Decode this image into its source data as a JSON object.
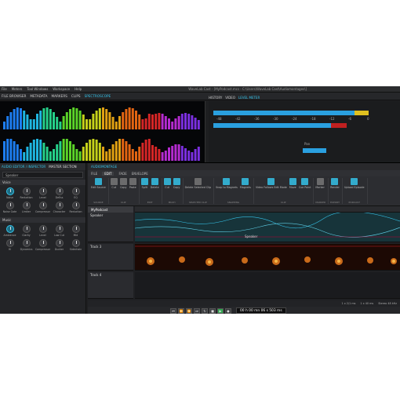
{
  "window": {
    "title": "WaveLab Cast - [MyPodcast.mcs - C:\\Users\\WaveLab Cast\\Audiomontages\\]"
  },
  "menu": [
    "File",
    "Meters",
    "Tool Windows",
    "Workspace",
    "Help"
  ],
  "top_tabs": [
    "FILE BROWSER",
    "METADATA",
    "MARKERS",
    "CLIPS",
    "SPECTROSCOPE"
  ],
  "top_tabs_active": 4,
  "right_tabs": [
    "HISTORY",
    "VIDEO",
    "LEVEL METER"
  ],
  "right_tabs_active": 2,
  "level_meter": {
    "scale": [
      "-48",
      "-42",
      "-36",
      "-30",
      "-24",
      "-18",
      "-12",
      "-6",
      "0"
    ],
    "mode_label": "Pan"
  },
  "left_panel": {
    "tabs": [
      "AUDIO EDITOR / INSPECTOR",
      "MASTER SECTION"
    ],
    "preset": "Speaker",
    "section_1": "Voice",
    "section_2": "Music",
    "knobs_1": [
      "Noise",
      "Reduction",
      "Level",
      "DeEss",
      "EQ",
      "Noise Gate",
      "Limiter",
      "Compressor",
      "Character",
      "Reduction"
    ],
    "knobs_2": [
      "Ambience",
      "Clarity",
      "Level",
      "Low Cut",
      "Mid",
      "Hi",
      "Dynamics",
      "Compressor",
      "Ducker",
      "Sidechain"
    ]
  },
  "editor": {
    "doc_tabs": [
      "AUDIOMONTAGE",
      "EDIT",
      "FADE",
      "ENVELOPE"
    ],
    "doc_tabs_active": 0,
    "ribbon_tabs": [
      "FILE",
      "EDIT",
      "FADE",
      "ENVELOPE"
    ],
    "ribbon_tabs_active": 1,
    "ribbon_groups": [
      {
        "label": "SOURCE",
        "buttons": [
          "Edit Source"
        ]
      },
      {
        "label": "CLIP",
        "buttons": [
          "Cut",
          "Copy",
          "Paste"
        ]
      },
      {
        "label": "EDIT",
        "buttons": [
          "Split",
          "Delete"
        ]
      },
      {
        "label": "MULTI",
        "buttons": [
          "Cut",
          "Copy"
        ]
      },
      {
        "label": "SELECTED CLIP",
        "buttons": [
          "Delete Selected Clip"
        ]
      },
      {
        "label": "SNAPPING",
        "buttons": [
          "Snap to Magnets",
          "Magnets"
        ]
      },
      {
        "label": "CLIP",
        "buttons": [
          "Video Follows Edit Mode",
          "Move",
          "Cue Point"
        ]
      },
      {
        "label": "MARKER",
        "buttons": [
          "Marker"
        ]
      },
      {
        "label": "EXPORT",
        "buttons": [
          "Render"
        ]
      },
      {
        "label": "PODCAST",
        "buttons": [
          "Upload Episode"
        ]
      }
    ],
    "file_tab": "MyPodcast",
    "tracks": [
      {
        "name": "Speaker",
        "clip": "Speaker"
      },
      {
        "name": "Track 3"
      },
      {
        "name": "Track 4"
      }
    ],
    "status": [
      "1 x 2/1 ms",
      "1 x 40 ms",
      "Stereo 48 kHz"
    ],
    "time": "00 h 00 mn 06 s 503 ms"
  }
}
